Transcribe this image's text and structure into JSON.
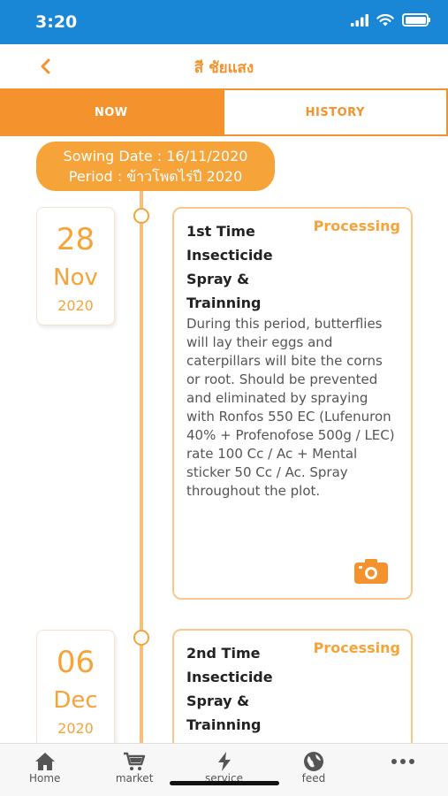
{
  "status_bar": {
    "time": "3:20"
  },
  "header": {
    "title": "สี ชัยแสง"
  },
  "tabs": [
    {
      "label": "NOW",
      "active": true
    },
    {
      "label": "HISTORY",
      "active": false
    }
  ],
  "sowing": {
    "date_line": "Sowing Date : 16/11/2020",
    "period_line": "Period : ข้าวโพดไร่ปี 2020"
  },
  "timeline": [
    {
      "day": "28",
      "month": "Nov",
      "year": "2020",
      "status": "Processing",
      "title": "1st Time Insecticide Spray & Trainning",
      "description": "During this period, butterflies will lay their eggs and caterpillars will bite the corns or root. Should be prevented and eliminated by spraying with Ronfos 550 EC (Lufenuron 40% + Profenofose 500g / LEC) rate 100 Cc / Ac + Mental sticker 50 Cc / Ac. Spray throughout the plot."
    },
    {
      "day": "06",
      "month": "Dec",
      "year": "2020",
      "status": "Processing",
      "title": "2nd Time Insecticide Spray & Trainning",
      "description": ""
    }
  ],
  "bottom_tabs": [
    {
      "label": "Home",
      "icon": "home-icon"
    },
    {
      "label": "market",
      "icon": "cart-icon"
    },
    {
      "label": "service",
      "icon": "bolt-icon"
    },
    {
      "label": "feed",
      "icon": "globe-icon"
    },
    {
      "label": "",
      "icon": "more-icon"
    }
  ],
  "colors": {
    "accent": "#f4922e",
    "status_bar": "#1a86d6",
    "card_border": "#f9c98a",
    "timeline": "#f7c07a"
  }
}
